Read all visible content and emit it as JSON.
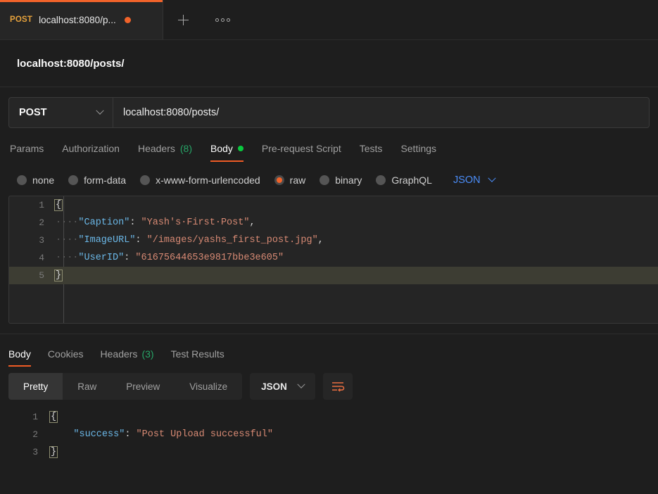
{
  "tabbar": {
    "tabs": [
      {
        "method": "POST",
        "title": "localhost:8080/p...",
        "unsaved": true
      }
    ],
    "new_tab_icon": "plus-icon",
    "more_icon": "dots-icon"
  },
  "request_header": {
    "name": "localhost:8080/posts/"
  },
  "urlbar": {
    "method": "POST",
    "url": "localhost:8080/posts/"
  },
  "request_tabs": [
    {
      "label": "Params",
      "active": false
    },
    {
      "label": "Authorization",
      "active": false
    },
    {
      "label": "Headers",
      "count": "(8)",
      "active": false
    },
    {
      "label": "Body",
      "active": true,
      "dot": true
    },
    {
      "label": "Pre-request Script",
      "active": false
    },
    {
      "label": "Tests",
      "active": false
    },
    {
      "label": "Settings",
      "active": false
    }
  ],
  "body_types": [
    {
      "label": "none",
      "selected": false
    },
    {
      "label": "form-data",
      "selected": false
    },
    {
      "label": "x-www-form-urlencoded",
      "selected": false
    },
    {
      "label": "raw",
      "selected": true
    },
    {
      "label": "binary",
      "selected": false
    },
    {
      "label": "GraphQL",
      "selected": false
    }
  ],
  "body_format": {
    "label": "JSON"
  },
  "request_body": {
    "lines": [
      {
        "num": "1",
        "brace": "{",
        "active": false
      },
      {
        "num": "2",
        "ws": "····",
        "key": "\"Caption\"",
        "colon": ": ",
        "value": "\"Yash's·First·Post\"",
        "comma": ",",
        "active": false
      },
      {
        "num": "3",
        "ws": "····",
        "key": "\"ImageURL\"",
        "colon": ": ",
        "value": "\"/images/yashs_first_post.jpg\"",
        "comma": ",",
        "active": false
      },
      {
        "num": "4",
        "ws": "····",
        "key": "\"UserID\"",
        "colon": ": ",
        "value": "\"61675644653e9817bbe3e605\"",
        "comma": "",
        "active": false
      },
      {
        "num": "5",
        "brace": "}",
        "active": true
      }
    ]
  },
  "response_tabs": [
    {
      "label": "Body",
      "active": true
    },
    {
      "label": "Cookies",
      "active": false
    },
    {
      "label": "Headers",
      "count": "(3)",
      "active": false
    },
    {
      "label": "Test Results",
      "active": false
    }
  ],
  "response_toolbar": {
    "views": [
      {
        "label": "Pretty",
        "active": true
      },
      {
        "label": "Raw",
        "active": false
      },
      {
        "label": "Preview",
        "active": false
      },
      {
        "label": "Visualize",
        "active": false
      }
    ],
    "format": "JSON",
    "wrap_icon": "word-wrap-icon"
  },
  "response_body": {
    "lines": [
      {
        "num": "1",
        "brace": "{"
      },
      {
        "num": "2",
        "ws": "    ",
        "key": "\"success\"",
        "colon": ": ",
        "value": "\"Post Upload successful\""
      },
      {
        "num": "3",
        "brace": "}"
      }
    ]
  },
  "colors": {
    "accent_orange": "#f1632a",
    "tab_underline": "#ef5b25",
    "json_blue": "#4b8df8",
    "key_blue": "#6bb8e8",
    "string_salmon": "#d88a74",
    "green_dot": "#0ac93f",
    "count_green": "#27a567",
    "background": "#1e1e1e",
    "active_line": "#3d3d33"
  }
}
